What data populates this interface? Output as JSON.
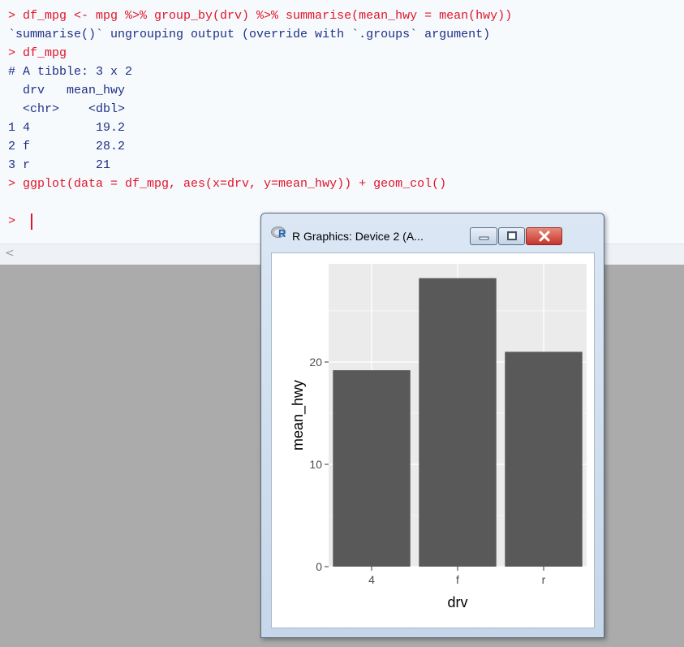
{
  "console": {
    "lines": [
      {
        "text": "> df_mpg <- mpg %>% group_by(drv) %>% summarise(mean_hwy = mean(hwy))",
        "kind": "cmd"
      },
      {
        "text": "`summarise()` ungrouping output (override with `.groups` argument)",
        "kind": "out"
      },
      {
        "text": "> df_mpg",
        "kind": "cmd"
      },
      {
        "text": "# A tibble: 3 x 2",
        "kind": "out"
      },
      {
        "text": "  drv   mean_hwy",
        "kind": "out"
      },
      {
        "text": "  <chr>    <dbl>",
        "kind": "out"
      },
      {
        "text": "1 4         19.2",
        "kind": "out"
      },
      {
        "text": "2 f         28.2",
        "kind": "out"
      },
      {
        "text": "3 r         21",
        "kind": "out"
      },
      {
        "text": "> ggplot(data = df_mpg, aes(x=drv, y=mean_hwy)) + geom_col()",
        "kind": "cmd"
      }
    ],
    "prompt": ">",
    "scroll_left_glyph": "<"
  },
  "graphics_window": {
    "title": "R Graphics: Device 2 (A...",
    "icon_letter": "R"
  },
  "colors": {
    "command_text": "#e0142a",
    "output_text": "#1e2f86",
    "panel_bg": "#ebebeb",
    "bar_fill": "#595959",
    "grid": "#ffffff"
  },
  "chart_data": {
    "type": "bar",
    "categories": [
      "4",
      "f",
      "r"
    ],
    "values": [
      19.2,
      28.2,
      21
    ],
    "xlabel": "drv",
    "ylabel": "mean_hwy",
    "ylim": [
      0,
      29.6
    ],
    "yticks": [
      0,
      10,
      20
    ],
    "ytick_labels": [
      "0",
      "10",
      "20"
    ],
    "grid": true
  }
}
